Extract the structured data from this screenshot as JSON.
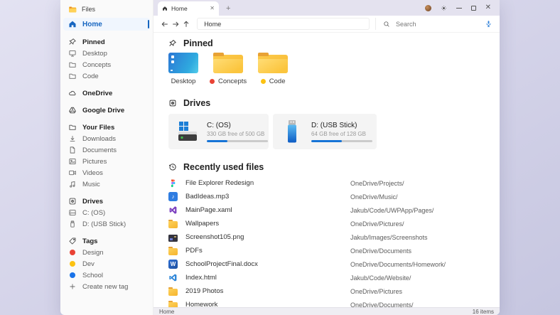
{
  "app": {
    "title": "Files"
  },
  "colors": {
    "accent_blue": "#1665c0",
    "progress_blue": "#1774d6",
    "tag_red": "#e94335",
    "tag_yellow": "#fcc212",
    "tag_blue": "#1a73e8",
    "desktop_wallpaper": "#d6d5ea",
    "folder_yellow": "#f7b42c"
  },
  "window_controls": {
    "minimize": "minimize",
    "maximize": "maximize",
    "close": "close"
  },
  "tab_bar": {
    "active_tab_label": "Home",
    "new_tab_button": "+",
    "close_tab": "✕"
  },
  "toolbar": {
    "address_value": "Home",
    "search_placeholder": "Search"
  },
  "sidebar": {
    "items": [
      {
        "label": "Home",
        "icon": "home",
        "state": "active"
      },
      {
        "label": "Pinned",
        "icon": "pin",
        "kind": "header"
      },
      {
        "label": "Desktop",
        "icon": "monitor"
      },
      {
        "label": "Concepts",
        "icon": "folder"
      },
      {
        "label": "Code",
        "icon": "folder"
      },
      {
        "label": "OneDrive",
        "icon": "cloud",
        "kind": "header"
      },
      {
        "label": "Google Drive",
        "icon": "google-drive",
        "kind": "header"
      },
      {
        "label": "Your Files",
        "icon": "folder",
        "kind": "header"
      },
      {
        "label": "Downloads",
        "icon": "download"
      },
      {
        "label": "Documents",
        "icon": "document"
      },
      {
        "label": "Pictures",
        "icon": "picture"
      },
      {
        "label": "Videos",
        "icon": "video"
      },
      {
        "label": "Music",
        "icon": "music"
      },
      {
        "label": "Drives",
        "icon": "drive",
        "kind": "header"
      },
      {
        "label": "C: (OS)",
        "icon": "hdd"
      },
      {
        "label": "D: (USB Stick)",
        "icon": "usb"
      },
      {
        "label": "Tags",
        "icon": "tag",
        "kind": "header"
      },
      {
        "label": "Design",
        "dot": "#e94335"
      },
      {
        "label": "Dev",
        "dot": "#fcc212"
      },
      {
        "label": "School",
        "dot": "#1a73e8"
      },
      {
        "label": "Create new tag",
        "icon": "plus"
      }
    ]
  },
  "sections": {
    "pinned": {
      "title": "Pinned",
      "tiles": [
        {
          "label": "Desktop",
          "kind": "desktop"
        },
        {
          "label": "Concepts",
          "kind": "folder",
          "tag_color": "#e94335"
        },
        {
          "label": "Code",
          "kind": "folder",
          "tag_color": "#fcc212"
        }
      ]
    },
    "drives": {
      "title": "Drives",
      "cards": [
        {
          "name": "C: (OS)",
          "free": "330 GB free of 500 GB",
          "used_percent": 34
        },
        {
          "name": "D: (USB Stick)",
          "free": "64 GB free of 128 GB",
          "used_percent": 50
        }
      ]
    },
    "recent": {
      "title": "Recently used files",
      "files": [
        {
          "name": "File Explorer Redesign",
          "path": "OneDrive/Projects/",
          "icon": "figma"
        },
        {
          "name": "BadIdeas.mp3",
          "path": "OneDrive/Music/",
          "icon": "audio"
        },
        {
          "name": "MainPage.xaml",
          "path": "Jakub/Code/UWPApp/Pages/",
          "icon": "visual-studio"
        },
        {
          "name": "Wallpapers",
          "path": "OneDrive/Pictures/",
          "icon": "folder"
        },
        {
          "name": "Screenshot105.png",
          "path": "Jakub/Images/Screenshots",
          "icon": "image"
        },
        {
          "name": "PDFs",
          "path": "OneDrive/Documents",
          "icon": "folder"
        },
        {
          "name": "SchoolProjectFinal.docx",
          "path": "OneDrive/Documents/Homework/",
          "icon": "word"
        },
        {
          "name": "Index.html",
          "path": "Jakub/Code/Website/",
          "icon": "vscode"
        },
        {
          "name": "2019 Photos",
          "path": "OneDrive/Pictures",
          "icon": "folder"
        },
        {
          "name": "Homework",
          "path": "OneDrive/Documents/",
          "icon": "folder"
        }
      ]
    }
  },
  "status_bar": {
    "location": "Home",
    "items_count": "16 items"
  }
}
